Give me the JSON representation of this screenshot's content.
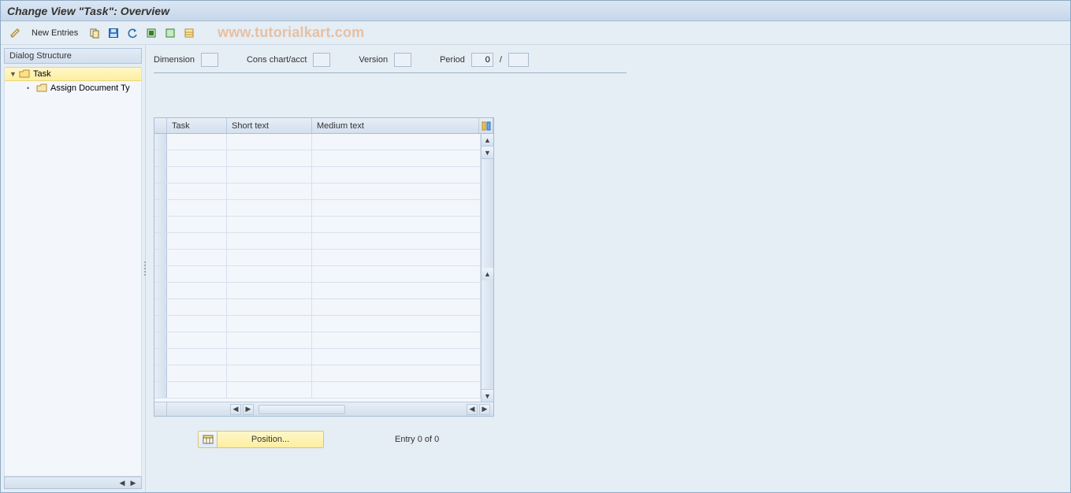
{
  "title": "Change View \"Task\": Overview",
  "toolbar": {
    "new_entries": "New Entries"
  },
  "watermark": "www.tutorialkart.com",
  "sidebar": {
    "header": "Dialog Structure",
    "items": [
      {
        "label": "Task"
      },
      {
        "label": "Assign Document Ty"
      }
    ]
  },
  "filters": {
    "dimension": {
      "label": "Dimension",
      "value": ""
    },
    "cons": {
      "label": "Cons chart/acct",
      "value": ""
    },
    "version": {
      "label": "Version",
      "value": ""
    },
    "period": {
      "label": "Period",
      "value": "0",
      "sep": "/",
      "value2": ""
    }
  },
  "table": {
    "columns": {
      "task": "Task",
      "short": "Short text",
      "medium": "Medium text"
    }
  },
  "footer": {
    "position_label": "Position...",
    "entry_text": "Entry 0 of 0"
  }
}
